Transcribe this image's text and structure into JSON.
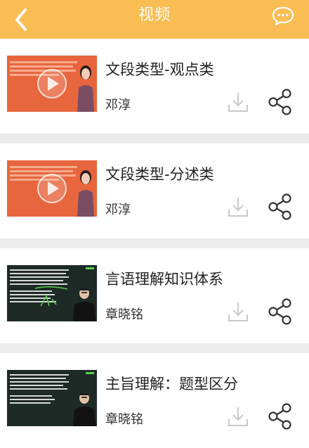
{
  "header": {
    "title": "视频",
    "back_icon": "chevron-left-icon",
    "chat_icon": "chat-bubble-icon"
  },
  "videos": [
    {
      "title": "文段类型-观点类",
      "author": "邓淳",
      "thumb_style": "orange"
    },
    {
      "title": "文段类型-分述类",
      "author": "邓淳",
      "thumb_style": "orange"
    },
    {
      "title": "言语理解知识体系",
      "author": "章晓铭",
      "thumb_style": "dark"
    },
    {
      "title": "主旨理解：题型区分",
      "author": "章晓铭",
      "thumb_style": "dark"
    }
  ],
  "colors": {
    "header_bg": "#f9bd54",
    "page_bg": "#ececec",
    "thumb_orange": "#e7663e",
    "thumb_dark": "#1d2a26"
  }
}
